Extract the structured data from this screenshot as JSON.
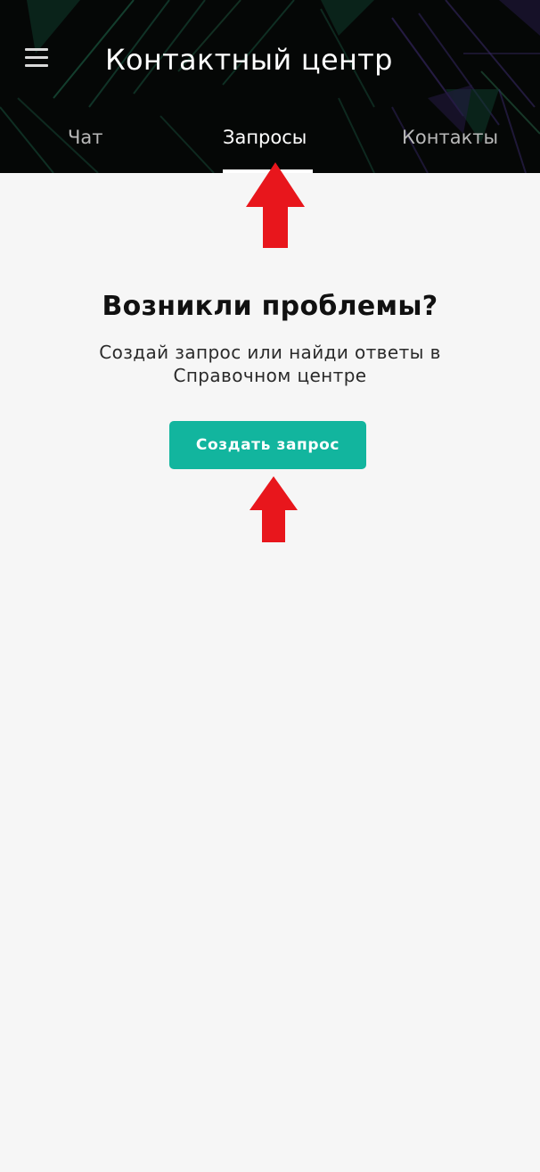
{
  "header": {
    "title": "Контактный центр",
    "menu_icon": "hamburger-menu-icon"
  },
  "tabs": [
    {
      "label": "Чат",
      "active": false
    },
    {
      "label": "Запросы",
      "active": true
    },
    {
      "label": "Контакты",
      "active": false
    }
  ],
  "main": {
    "title": "Возникли проблемы?",
    "subtitle": "Создай запрос или найди ответы в Справочном центре",
    "create_button_label": "Создать запрос"
  },
  "annotations": {
    "arrow_color": "#e8161c",
    "arrow_icon": "up-arrow-icon"
  },
  "colors": {
    "accent": "#12b59e",
    "header_bg": "#050706",
    "page_bg": "#f6f6f6"
  }
}
